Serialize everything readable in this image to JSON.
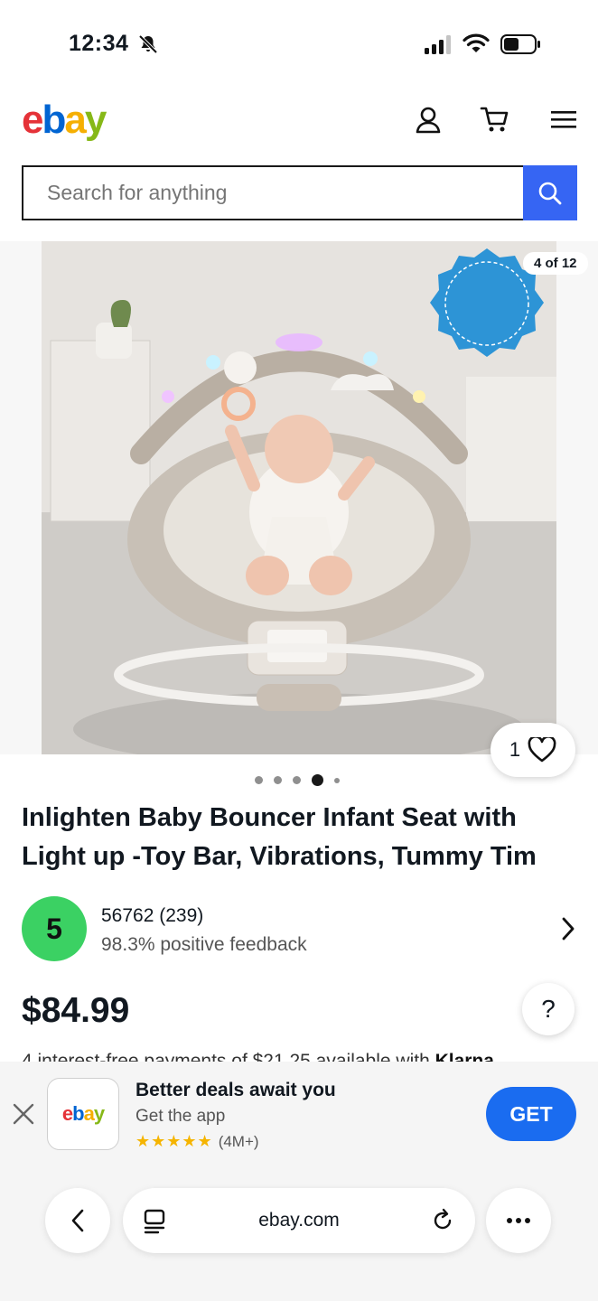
{
  "status_bar": {
    "time": "12:34",
    "icons": [
      "bell-off-icon",
      "signal-icon",
      "wifi-icon",
      "battery-icon"
    ]
  },
  "header": {
    "logo": {
      "e": "e",
      "b": "b",
      "a": "a",
      "y": "y"
    },
    "icons": [
      "account-icon",
      "cart-icon",
      "menu-icon"
    ]
  },
  "search": {
    "placeholder": "Search for anything",
    "button_icon": "search-icon",
    "accent": "#3665f3"
  },
  "gallery": {
    "counter": "4 of 12",
    "watch_count": "1",
    "total_images": 5,
    "active_index": 4
  },
  "product": {
    "title": "Inlighten Baby Bouncer Infant Seat with Light up -Toy Bar, Vibrations, Tummy Tim",
    "price": "$84.99",
    "financing": "4 interest-free payments of $21.25 available with",
    "financing_brand": "Klarna"
  },
  "seller": {
    "badge": "5",
    "name_and_score": "56762 (239)",
    "feedback": "98.3% positive feedback",
    "badge_color": "#3bd163"
  },
  "help": {
    "label": "?"
  },
  "app_banner": {
    "title": "Better deals await you",
    "subtitle": "Get the app",
    "stars": "★★★★★",
    "rating_count": "(4M+)",
    "cta": "GET",
    "cta_color": "#1a6cf0"
  },
  "browser": {
    "url": "ebay.com"
  }
}
